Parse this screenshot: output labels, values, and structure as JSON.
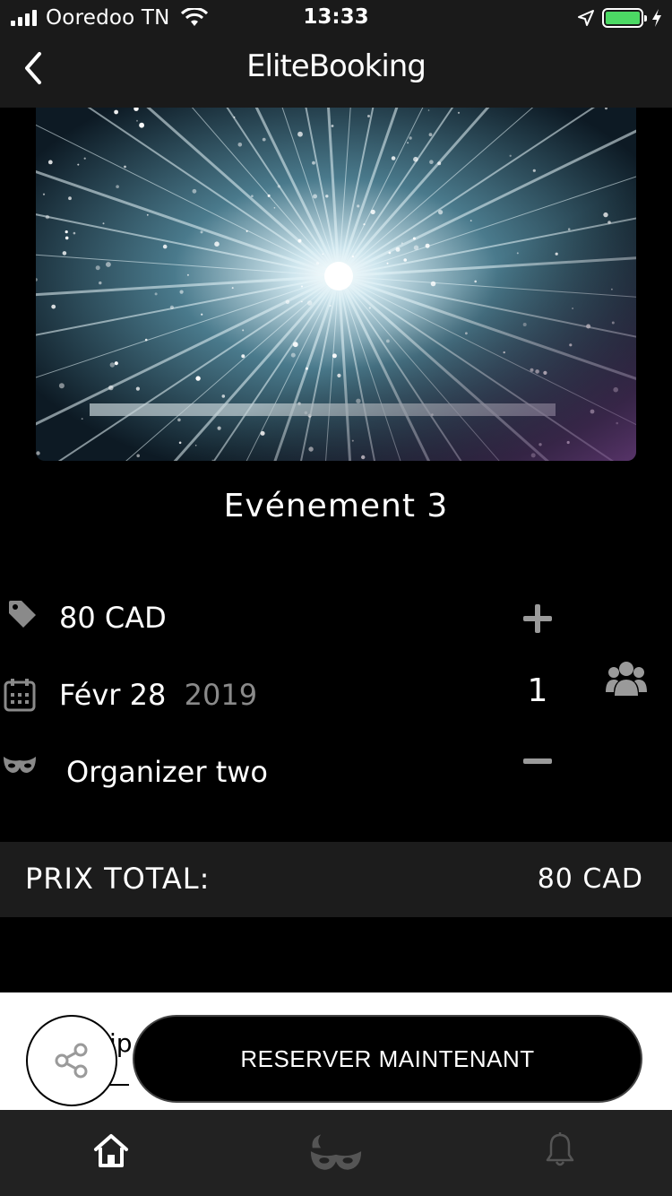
{
  "status_bar": {
    "carrier": "Ooredoo TN",
    "time": "13:33",
    "battery_level": 1.0,
    "battery_color": "#4cd964"
  },
  "header": {
    "title": "EliteBooking",
    "back_icon": "chevron-left-icon"
  },
  "event": {
    "title": "Evénement 3",
    "price": "80 CAD",
    "date_day": "Févr 28",
    "date_year": "2019",
    "organizer": "Organizer two"
  },
  "quantity": {
    "value": "1"
  },
  "total": {
    "label": "PRIX TOTAL:",
    "value": "80 CAD"
  },
  "actions": {
    "reserve_label": "RESERVER MAINTENANT",
    "partial_text": "ip"
  },
  "tabs": [
    {
      "icon": "home-icon",
      "active": true
    },
    {
      "icon": "mask-icon",
      "active": false
    },
    {
      "icon": "bell-icon",
      "active": false
    }
  ]
}
